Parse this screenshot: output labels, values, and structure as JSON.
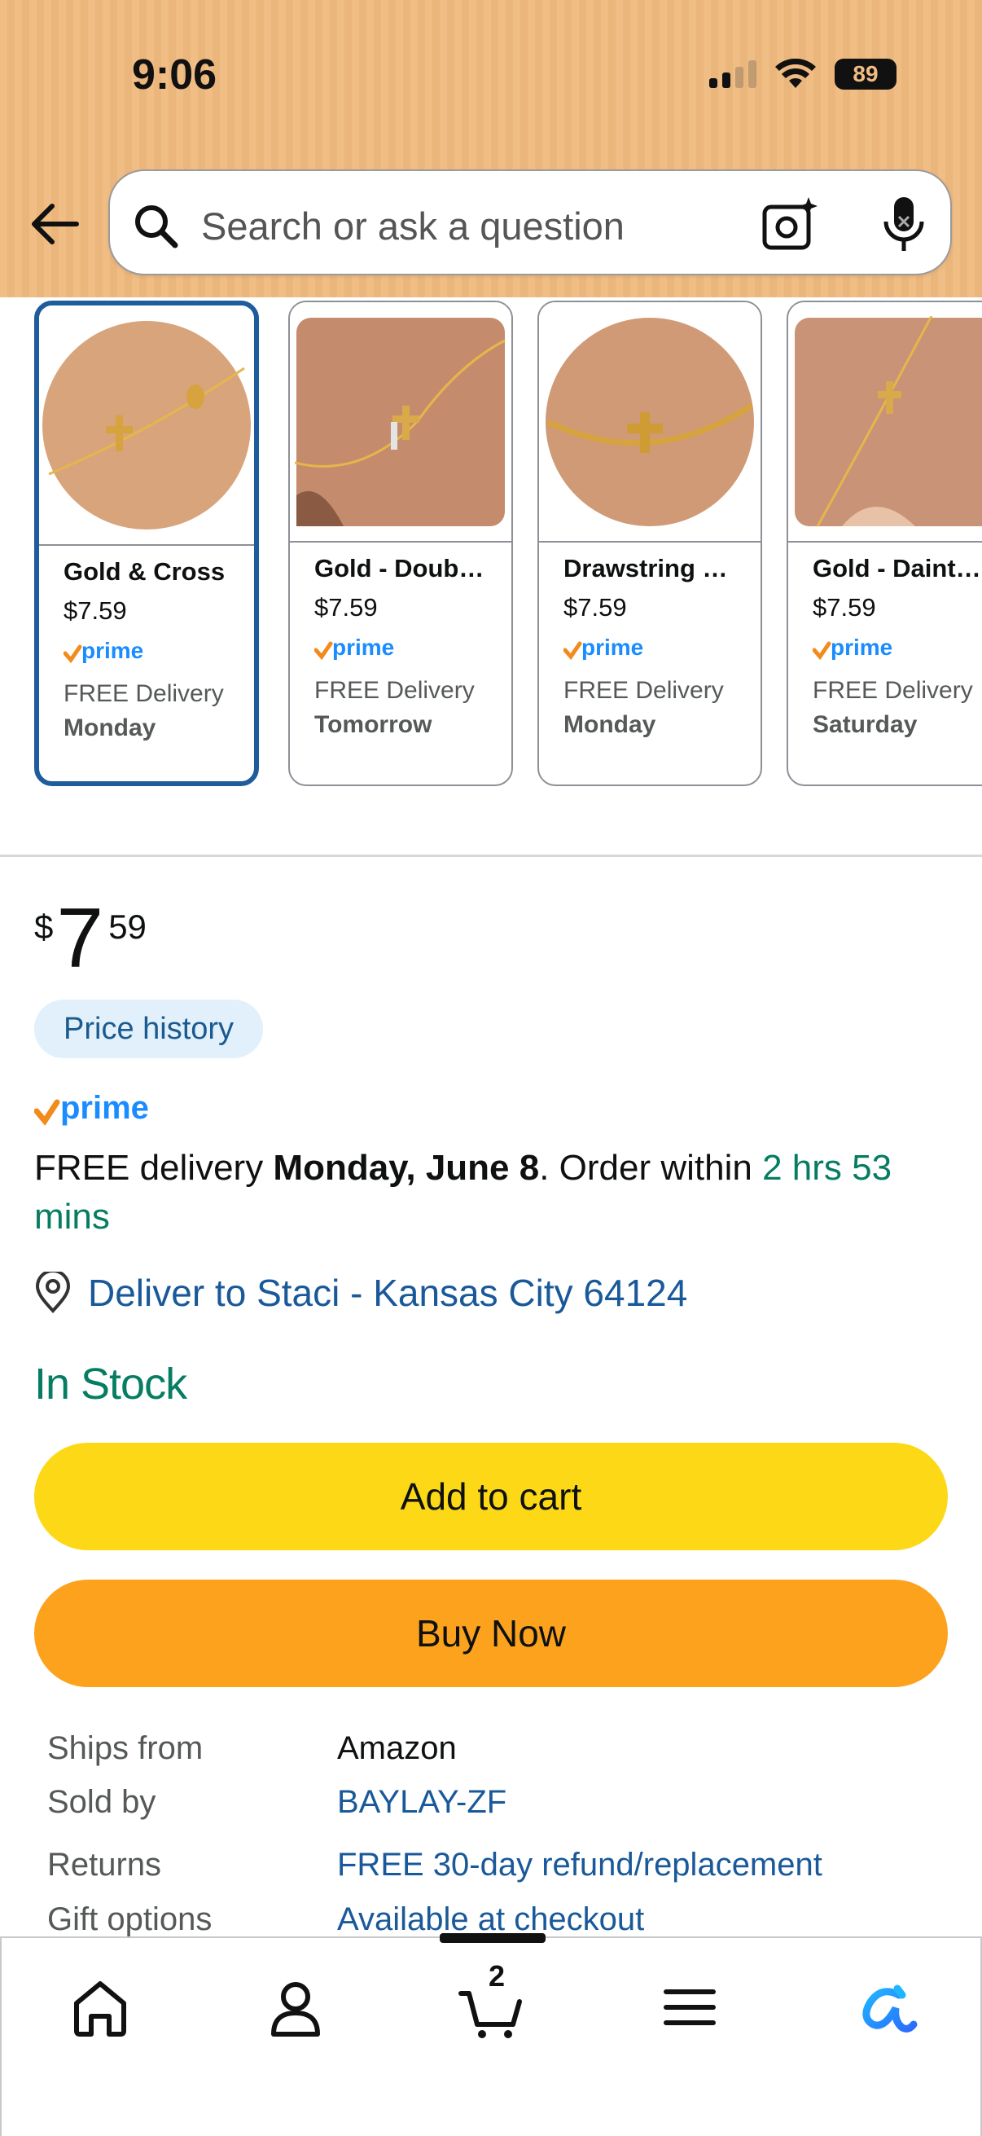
{
  "status_bar": {
    "time": "9:06",
    "battery": "89"
  },
  "search": {
    "placeholder": "Search or ask a question"
  },
  "carousel": [
    {
      "name": "Gold & Cross",
      "price": "$7.59",
      "delivery": "FREE Delivery",
      "day": "Monday",
      "selected": true
    },
    {
      "name": "Gold - Doub…",
      "price": "$7.59",
      "delivery": "FREE Delivery",
      "day": "Tomorrow",
      "selected": false
    },
    {
      "name": "Drawstring …",
      "price": "$7.59",
      "delivery": "FREE Delivery",
      "day": "Monday",
      "selected": false
    },
    {
      "name": "Gold - Daint…",
      "price": "$7.59",
      "delivery": "FREE Delivery",
      "day": "Saturday",
      "selected": false
    }
  ],
  "price": {
    "currency": "$",
    "whole": "7",
    "fraction": "59"
  },
  "price_history_label": "Price history",
  "prime_label": "prime",
  "delivery": {
    "prefix": "FREE delivery ",
    "date": "Monday, June 8",
    "middle": ". Order within ",
    "countdown": "2 hrs 53 mins"
  },
  "deliver_to": "Deliver to Staci - Kansas City 64124",
  "stock_status": "In Stock",
  "buttons": {
    "add_to_cart": "Add to cart",
    "buy_now": "Buy Now"
  },
  "details": [
    {
      "label": "Ships from",
      "value": "Amazon",
      "link": false
    },
    {
      "label": "Sold by",
      "value": "BAYLAY-ZF",
      "link": true
    },
    {
      "label": "Returns",
      "value": "FREE 30-day refund/replacement",
      "link": true
    },
    {
      "label": "Gift options",
      "value": "Available at checkout",
      "link": true
    }
  ],
  "nav": {
    "cart_count": "2"
  },
  "colors": {
    "header_bg": "#f0bd84",
    "add_to_cart": "#fdd816",
    "buy_now": "#fca21d",
    "link": "#1a5999",
    "in_stock": "#067d62",
    "prime_blue": "#1a8cff",
    "prime_check": "#f28a1c"
  }
}
